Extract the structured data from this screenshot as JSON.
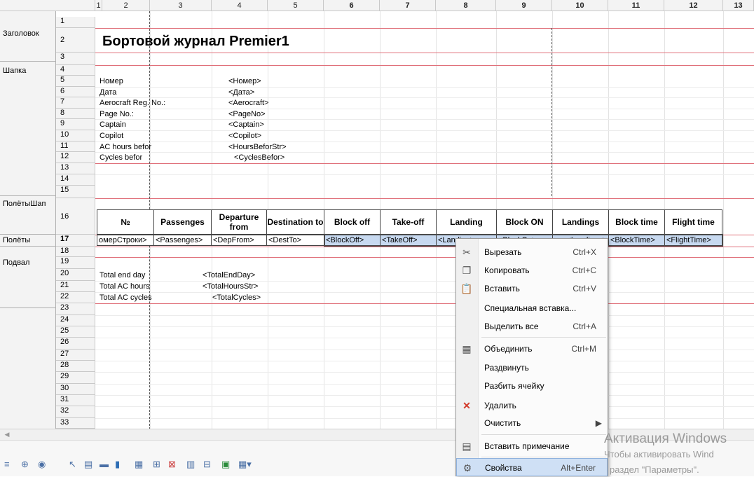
{
  "columns": [
    "1",
    "2",
    "3",
    "4",
    "5",
    "6",
    "7",
    "8",
    "9",
    "10",
    "11",
    "12",
    "13"
  ],
  "rows": [
    "1",
    "2",
    "3",
    "4",
    "5",
    "6",
    "7",
    "8",
    "9",
    "10",
    "11",
    "12",
    "13",
    "14",
    "15",
    "16",
    "17",
    "18",
    "19",
    "20",
    "21",
    "22",
    "23",
    "24",
    "25",
    "26",
    "27",
    "28",
    "29",
    "30",
    "31",
    "32",
    "33"
  ],
  "groups": {
    "title": "Заголовок",
    "header": "Шапка",
    "flights_header": "ПолётыШап",
    "flights": "Полёты",
    "footer": "Подвал"
  },
  "report_title": "Бортовой журнал Premier1",
  "header_fields": [
    {
      "label": "Номер",
      "param": "<Номер>"
    },
    {
      "label": "Дата",
      "param": "<Дата>"
    },
    {
      "label": "Aerocraft Reg. No.:",
      "param": "<Aerocraft>"
    },
    {
      "label": "Page No.:",
      "param": "<PageNo>"
    },
    {
      "label": "Captain",
      "param": "<Captain>"
    },
    {
      "label": "Copilot",
      "param": "<Copilot>"
    },
    {
      "label": "AC hours befor",
      "param": "<HoursBeforStr>"
    },
    {
      "label": "Cycles befor",
      "param": "<CyclesBefor>"
    }
  ],
  "table_headers": [
    "№",
    "Passenges",
    "Departure from",
    "Destination to",
    "Block off",
    "Take-off",
    "Landing",
    "Block ON",
    "Landings",
    "Block time",
    "Flight time"
  ],
  "table_params": [
    "омерСтроки>",
    "<Passenges>",
    "<DepFrom>",
    "<DestTo>",
    "<BlockOff>",
    "<TakeOff>",
    "<Landing>",
    "<BlockOn>",
    "<Landings>",
    "<BlockTime>",
    "<FlightTime>"
  ],
  "footer_fields": [
    {
      "label": "Total end day",
      "param": "<TotalEndDay>"
    },
    {
      "label": "Total AC hours",
      "param": "<TotalHoursStr>"
    },
    {
      "label": "Total AC cycles",
      "param": "<TotalCycles>"
    }
  ],
  "context_menu": [
    {
      "label": "Вырезать",
      "shortcut": "Ctrl+X",
      "icon": "scissors-icon"
    },
    {
      "label": "Копировать",
      "shortcut": "Ctrl+C",
      "icon": "copy-icon"
    },
    {
      "label": "Вставить",
      "shortcut": "Ctrl+V",
      "icon": "paste-icon"
    },
    {
      "label": "Специальная вставка...",
      "shortcut": "",
      "icon": ""
    },
    {
      "label": "Выделить все",
      "shortcut": "Ctrl+A",
      "icon": ""
    },
    {
      "label": "Объединить",
      "shortcut": "Ctrl+M",
      "icon": "merge-cells-icon"
    },
    {
      "label": "Раздвинуть",
      "shortcut": "",
      "icon": ""
    },
    {
      "label": "Разбить ячейку",
      "shortcut": "",
      "icon": ""
    },
    {
      "label": "Удалить",
      "shortcut": "",
      "icon": "delete-x-icon"
    },
    {
      "label": "Очистить",
      "shortcut": "",
      "icon": "",
      "submenu": true
    },
    {
      "label": "Вставить примечание",
      "shortcut": "",
      "icon": "note-icon"
    },
    {
      "label": "Свойства",
      "shortcut": "Alt+Enter",
      "icon": "properties-icon"
    }
  ],
  "watermark": {
    "line1": "Активация Windows",
    "line2": "Чтобы активировать Wind",
    "line3": "раздел \"Параметры\"."
  },
  "colors": {
    "group_line": "#e0707a",
    "selection": "#c7d9f0",
    "menu_highlight": "#cfe0f5"
  }
}
